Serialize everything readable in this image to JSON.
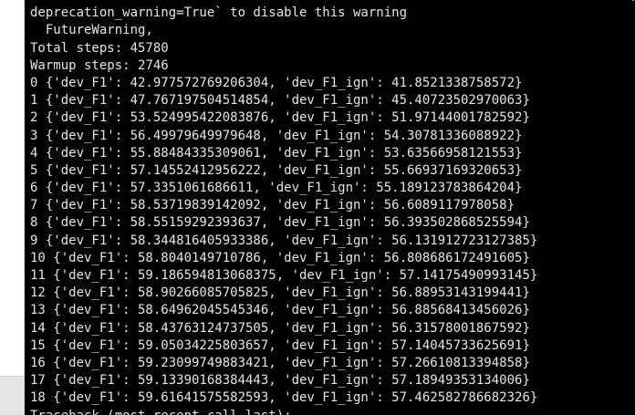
{
  "terminal": {
    "lines": [
      "                                                                              ,",
      "deprecation_warning=True` to disable this warning",
      "  FutureWarning,",
      "Total steps: 45780",
      "Warmup steps: 2746",
      "0 {'dev_F1': 42.977572769206304, 'dev_F1_ign': 41.8521338758572}",
      "1 {'dev_F1': 47.767197504514854, 'dev_F1_ign': 45.40723502970063}",
      "2 {'dev_F1': 53.524995422083876, 'dev_F1_ign': 51.97144001782592}",
      "3 {'dev_F1': 56.49979649979648, 'dev_F1_ign': 54.30781336088922}",
      "4 {'dev_F1': 55.88484335309061, 'dev_F1_ign': 53.63566958121553}",
      "5 {'dev_F1': 57.14552412956222, 'dev_F1_ign': 55.66937169320653}",
      "6 {'dev_F1': 57.3351061686611, 'dev_F1_ign': 55.189123783864204}",
      "7 {'dev_F1': 58.53719839142092, 'dev_F1_ign': 56.6089117978058}",
      "8 {'dev_F1': 58.55159292393637, 'dev_F1_ign': 56.393502868525594}",
      "9 {'dev_F1': 58.344816405933386, 'dev_F1_ign': 56.131912723127385}",
      "10 {'dev_F1': 58.8040149710786, 'dev_F1_ign': 56.808686172491605}",
      "11 {'dev_F1': 59.186594813068375, 'dev_F1_ign': 57.14175490993145}",
      "12 {'dev_F1': 58.90266085705825, 'dev_F1_ign': 56.88953143199441}",
      "13 {'dev_F1': 58.64962045545346, 'dev_F1_ign': 56.88568413456026}",
      "14 {'dev_F1': 58.43763124737505, 'dev_F1_ign': 56.31578001867592}",
      "15 {'dev_F1': 59.05034225803657, 'dev_F1_ign': 57.14045733625691}",
      "16 {'dev_F1': 59.23099749883421, 'dev_F1_ign': 57.26610813394858}",
      "17 {'dev_F1': 59.13390168384443, 'dev_F1_ign': 57.18949353134006}",
      "18 {'dev_F1': 59.61641575582593, 'dev_F1_ign': 57.462582786682326}",
      "Traceback (most recent call last):"
    ]
  }
}
